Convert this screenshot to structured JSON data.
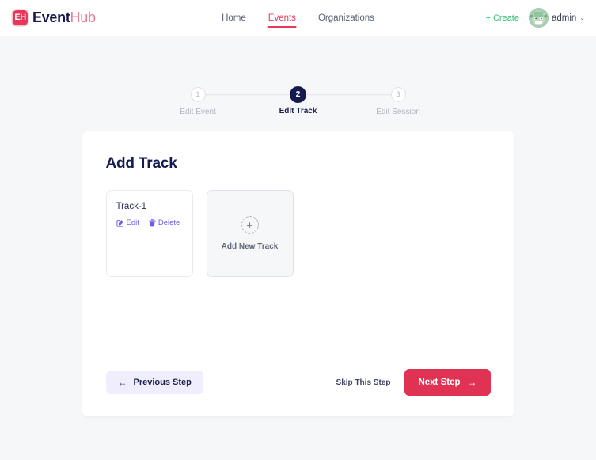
{
  "brand": {
    "mark": "EH",
    "name_first": "Event",
    "name_second": "Hub"
  },
  "nav": {
    "items": [
      {
        "label": "Home",
        "active": false
      },
      {
        "label": "Events",
        "active": true
      },
      {
        "label": "Organizations",
        "active": false
      }
    ],
    "create_label": "+ Create",
    "user_name": "admin",
    "chevron": "⌄"
  },
  "stepper": {
    "steps": [
      {
        "number": "1",
        "label": "Edit Event",
        "active": false
      },
      {
        "number": "2",
        "label": "Edit Track",
        "active": true
      },
      {
        "number": "3",
        "label": "Edit Session",
        "active": false
      }
    ]
  },
  "panel": {
    "title": "Add Track",
    "tracks": [
      {
        "name": "Track-1",
        "edit_label": "Edit",
        "delete_label": "Delete"
      }
    ],
    "add_card": {
      "plus": "+",
      "label": "Add New Track"
    },
    "footer": {
      "previous_label": "Previous Step",
      "previous_arrow": "←",
      "skip_label": "Skip This Step",
      "next_label": "Next Step",
      "next_arrow": "→"
    }
  },
  "colors": {
    "accent_pink": "#e8385a",
    "navy": "#141b4d",
    "green": "#2fbf71",
    "purple": "#6c5ce7",
    "page_bg": "#f6f7f9"
  }
}
